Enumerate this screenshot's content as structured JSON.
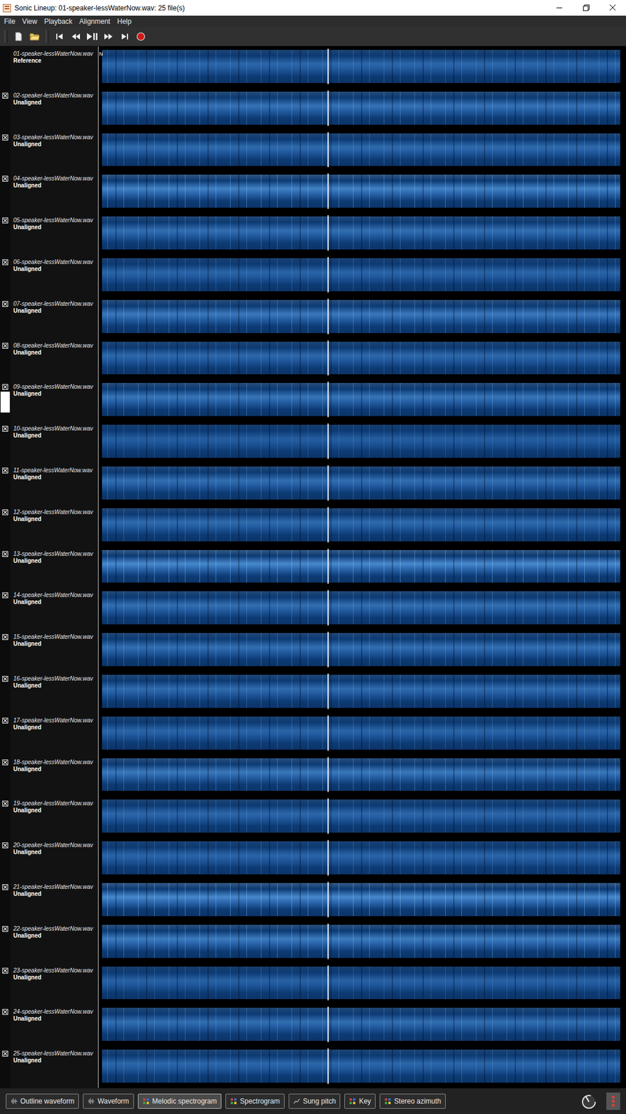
{
  "window": {
    "title": "Sonic Lineup: 01-speaker-lessWaterNow.wav: 25 file(s)"
  },
  "menu": [
    "File",
    "View",
    "Playback",
    "Alignment",
    "Help"
  ],
  "playhead": 0.435,
  "tracks": [
    {
      "name": "01-speaker-lessWaterNow.wav",
      "status": "Reference",
      "marker": "N",
      "closable": false,
      "selected": false,
      "level": 0.35
    },
    {
      "name": "02-speaker-lessWaterNow.wav",
      "status": "Unaligned",
      "marker": "",
      "closable": true,
      "selected": false,
      "level": 0.5
    },
    {
      "name": "03-speaker-lessWaterNow.wav",
      "status": "Unaligned",
      "marker": "",
      "closable": true,
      "selected": false,
      "level": 0.4
    },
    {
      "name": "04-speaker-lessWaterNow.wav",
      "status": "Unaligned",
      "marker": "",
      "closable": true,
      "selected": false,
      "level": 0.75
    },
    {
      "name": "05-speaker-lessWaterNow.wav",
      "status": "Unaligned",
      "marker": "",
      "closable": true,
      "selected": false,
      "level": 0.45
    },
    {
      "name": "06-speaker-lessWaterNow.wav",
      "status": "Unaligned",
      "marker": "",
      "closable": true,
      "selected": false,
      "level": 0.3
    },
    {
      "name": "07-speaker-lessWaterNow.wav",
      "status": "Unaligned",
      "marker": "",
      "closable": true,
      "selected": false,
      "level": 0.6
    },
    {
      "name": "08-speaker-lessWaterNow.wav",
      "status": "Unaligned",
      "marker": "",
      "closable": true,
      "selected": false,
      "level": 0.35
    },
    {
      "name": "09-speaker-lessWaterNow.wav",
      "status": "Unaligned",
      "marker": "",
      "closable": true,
      "selected": true,
      "level": 0.55
    },
    {
      "name": "10-speaker-lessWaterNow.wav",
      "status": "Unaligned",
      "marker": "",
      "closable": true,
      "selected": false,
      "level": 0.2
    },
    {
      "name": "11-speaker-lessWaterNow.wav",
      "status": "Unaligned",
      "marker": "",
      "closable": true,
      "selected": false,
      "level": 0.45
    },
    {
      "name": "12-speaker-lessWaterNow.wav",
      "status": "Unaligned",
      "marker": "",
      "closable": true,
      "selected": false,
      "level": 0.4
    },
    {
      "name": "13-speaker-lessWaterNow.wav",
      "status": "Unaligned",
      "marker": "",
      "closable": true,
      "selected": false,
      "level": 0.85
    },
    {
      "name": "14-speaker-lessWaterNow.wav",
      "status": "Unaligned",
      "marker": "",
      "closable": true,
      "selected": false,
      "level": 0.45
    },
    {
      "name": "15-speaker-lessWaterNow.wav",
      "status": "Unaligned",
      "marker": "",
      "closable": true,
      "selected": false,
      "level": 0.45
    },
    {
      "name": "16-speaker-lessWaterNow.wav",
      "status": "Unaligned",
      "marker": "",
      "closable": true,
      "selected": false,
      "level": 0.4
    },
    {
      "name": "17-speaker-lessWaterNow.wav",
      "status": "Unaligned",
      "marker": "",
      "closable": true,
      "selected": false,
      "level": 0.3
    },
    {
      "name": "18-speaker-lessWaterNow.wav",
      "status": "Unaligned",
      "marker": "",
      "closable": true,
      "selected": false,
      "level": 0.6
    },
    {
      "name": "19-speaker-lessWaterNow.wav",
      "status": "Unaligned",
      "marker": "",
      "closable": true,
      "selected": false,
      "level": 0.35
    },
    {
      "name": "20-speaker-lessWaterNow.wav",
      "status": "Unaligned",
      "marker": "",
      "closable": true,
      "selected": false,
      "level": 0.3
    },
    {
      "name": "21-speaker-lessWaterNow.wav",
      "status": "Unaligned",
      "marker": "",
      "closable": true,
      "selected": false,
      "level": 0.85
    },
    {
      "name": "22-speaker-lessWaterNow.wav",
      "status": "Unaligned",
      "marker": "",
      "closable": true,
      "selected": false,
      "level": 0.65
    },
    {
      "name": "23-speaker-lessWaterNow.wav",
      "status": "Unaligned",
      "marker": "",
      "closable": true,
      "selected": false,
      "level": 0.25
    },
    {
      "name": "24-speaker-lessWaterNow.wav",
      "status": "Unaligned",
      "marker": "",
      "closable": true,
      "selected": false,
      "level": 0.45
    },
    {
      "name": "25-speaker-lessWaterNow.wav",
      "status": "Unaligned",
      "marker": "",
      "closable": true,
      "selected": false,
      "level": 0.35
    }
  ],
  "views": [
    {
      "label": "Outline waveform",
      "kind": "waveform",
      "selected": false
    },
    {
      "label": "Waveform",
      "kind": "waveform",
      "selected": false
    },
    {
      "label": "Melodic spectrogram",
      "kind": "grid",
      "selected": true
    },
    {
      "label": "Spectrogram",
      "kind": "grid",
      "selected": false
    },
    {
      "label": "Sung pitch",
      "kind": "pitch",
      "selected": false
    },
    {
      "label": "Key",
      "kind": "grid",
      "selected": false
    },
    {
      "label": "Stereo azimuth",
      "kind": "grid",
      "selected": false
    }
  ]
}
